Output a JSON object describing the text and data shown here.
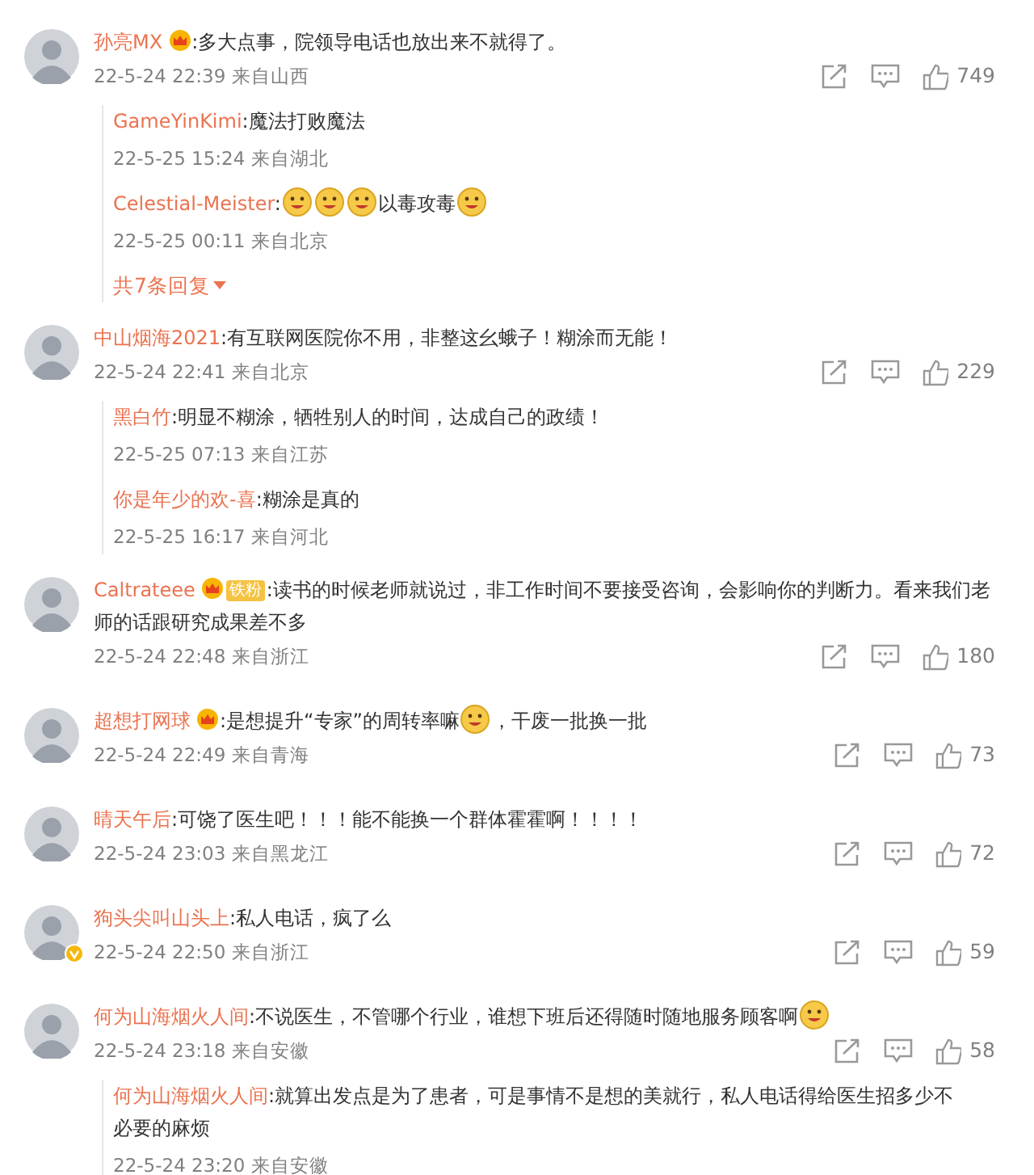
{
  "comments": [
    {
      "user": "孙亮MX",
      "crown": true,
      "verified": false,
      "segments": [
        {
          "kind": "text",
          "text": ":多大点事，院领导电话也放出来不就得了。"
        }
      ],
      "time": "22-5-24 22:39 来自山西",
      "likes": "749",
      "replies": [
        {
          "user": "GameYinKimi",
          "segments": [
            {
              "kind": "text",
              "text": ":魔法打败魔法"
            }
          ],
          "time": "22-5-25 15:24 来自湖北"
        },
        {
          "user": "Celestial-Meister",
          "segments": [
            {
              "kind": "text",
              "text": ":"
            },
            {
              "kind": "emoji"
            },
            {
              "kind": "emoji"
            },
            {
              "kind": "emoji"
            },
            {
              "kind": "text",
              "text": "以毒攻毒"
            },
            {
              "kind": "emoji"
            }
          ],
          "time": "22-5-25 00:11 来自北京"
        }
      ],
      "more": "共7条回复"
    },
    {
      "user": "中山烟海2021",
      "crown": false,
      "verified": false,
      "segments": [
        {
          "kind": "text",
          "text": ":有互联网医院你不用，非整这幺蛾子！糊涂而无能！"
        }
      ],
      "time": "22-5-24 22:41 来自北京",
      "likes": "229",
      "replies": [
        {
          "user": "黑白竹",
          "segments": [
            {
              "kind": "text",
              "text": ":明显不糊涂，牺牲别人的时间，达成自己的政绩！"
            }
          ],
          "time": "22-5-25 07:13 来自江苏"
        },
        {
          "user": "你是年少的欢-喜",
          "segments": [
            {
              "kind": "text",
              "text": ":糊涂是真的"
            }
          ],
          "time": "22-5-25 16:17 来自河北"
        }
      ]
    },
    {
      "user": "Caltrateee",
      "crown": true,
      "badge": "铁粉",
      "verified": false,
      "segments": [
        {
          "kind": "text",
          "text": ":读书的时候老师就说过，非工作时间不要接受咨询，会影响你的判断力。看来我们老师的话跟研究成果差不多"
        }
      ],
      "time": "22-5-24 22:48 来自浙江",
      "likes": "180"
    },
    {
      "user": "超想打网球",
      "crown": true,
      "verified": false,
      "segments": [
        {
          "kind": "text",
          "text": ":是想提升“专家”的周转率嘛"
        },
        {
          "kind": "emoji"
        },
        {
          "kind": "text",
          "text": "，干废一批换一批"
        }
      ],
      "time": "22-5-24 22:49 来自青海",
      "likes": "73"
    },
    {
      "user": "晴天午后",
      "crown": false,
      "verified": false,
      "segments": [
        {
          "kind": "text",
          "text": ":可饶了医生吧！！！能不能换一个群体霍霍啊！！！！"
        }
      ],
      "time": "22-5-24 23:03 来自黑龙江",
      "likes": "72"
    },
    {
      "user": "狗头尖叫山头上",
      "crown": false,
      "verified": true,
      "segments": [
        {
          "kind": "text",
          "text": ":私人电话，疯了么"
        }
      ],
      "time": "22-5-24 22:50 来自浙江",
      "likes": "59"
    },
    {
      "user": "何为山海烟火人间",
      "crown": false,
      "verified": false,
      "segments": [
        {
          "kind": "text",
          "text": ":不说医生，不管哪个行业，谁想下班后还得随时随地服务顾客啊"
        },
        {
          "kind": "emoji"
        }
      ],
      "time": "22-5-24 23:18 来自安徽",
      "likes": "58",
      "replies": [
        {
          "user": "何为山海烟火人间",
          "segments": [
            {
              "kind": "text",
              "text": ":就算出发点是为了患者，可是事情不是想的美就行，私人电话得给医生招多少不必要的麻烦"
            }
          ],
          "time": "22-5-24 23:20 来自安徽"
        }
      ]
    }
  ]
}
